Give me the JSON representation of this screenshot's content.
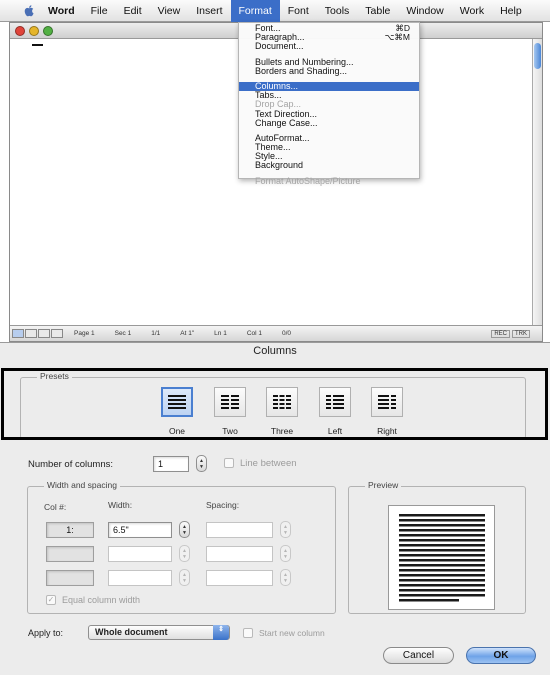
{
  "menubar": {
    "items": [
      {
        "label": "Word",
        "app": true
      },
      {
        "label": "File"
      },
      {
        "label": "Edit"
      },
      {
        "label": "View"
      },
      {
        "label": "Insert"
      },
      {
        "label": "Format",
        "active": true
      },
      {
        "label": "Font"
      },
      {
        "label": "Tools"
      },
      {
        "label": "Table"
      },
      {
        "label": "Window"
      },
      {
        "label": "Work"
      },
      {
        "label": "Help"
      }
    ]
  },
  "format_menu": {
    "items": [
      {
        "label": "Font...",
        "shortcut": "⌘D"
      },
      {
        "label": "Paragraph...",
        "shortcut": "⌥⌘M"
      },
      {
        "label": "Document..."
      },
      {
        "separator": true
      },
      {
        "label": "Bullets and Numbering..."
      },
      {
        "label": "Borders and Shading..."
      },
      {
        "separator": true
      },
      {
        "label": "Columns...",
        "selected": true
      },
      {
        "label": "Tabs..."
      },
      {
        "label": "Drop Cap...",
        "disabled": true
      },
      {
        "label": "Text Direction..."
      },
      {
        "label": "Change Case..."
      },
      {
        "separator": true
      },
      {
        "label": "AutoFormat..."
      },
      {
        "label": "Theme..."
      },
      {
        "label": "Style..."
      },
      {
        "label": "Background"
      },
      {
        "separator": true
      },
      {
        "label": "Format AutoShape/Picture",
        "disabled": true
      }
    ]
  },
  "statusbar": {
    "page": "Page 1",
    "sec": "Sec 1",
    "pages": "1/1",
    "at": "At 1\"",
    "ln": "Ln 1",
    "col": "Col 1",
    "words": "0/0",
    "rec": "REC",
    "trk": "TRK"
  },
  "dialog": {
    "title": "Columns",
    "presets_label": "Presets",
    "presets": [
      {
        "label": "One",
        "icon": "one-column-icon",
        "selected": true
      },
      {
        "label": "Two",
        "icon": "two-columns-icon"
      },
      {
        "label": "Three",
        "icon": "three-columns-icon"
      },
      {
        "label": "Left",
        "icon": "left-columns-icon"
      },
      {
        "label": "Right",
        "icon": "right-columns-icon"
      }
    ],
    "number_of_columns_label": "Number of columns:",
    "number_of_columns_value": "1",
    "line_between_label": "Line between",
    "width_spacing_label": "Width and spacing",
    "col_header": "Col #:",
    "width_header": "Width:",
    "spacing_header": "Spacing:",
    "row1_col": "1:",
    "row1_width": "6.5\"",
    "equal_width_label": "Equal column width",
    "preview_label": "Preview",
    "apply_to_label": "Apply to:",
    "apply_to_value": "Whole document",
    "start_new_column_label": "Start new column",
    "cancel_label": "Cancel",
    "ok_label": "OK"
  },
  "colors": {
    "selection_blue": "#3b6ec8",
    "dialog_bg": "#ececec",
    "highlight_frame": "#000000"
  }
}
